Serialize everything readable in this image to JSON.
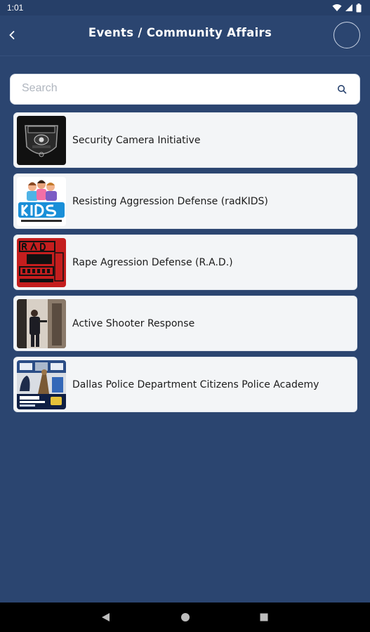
{
  "status_bar": {
    "time": "1:01"
  },
  "app_bar": {
    "title": "Events / Community Affairs"
  },
  "search": {
    "placeholder": "Search",
    "value": ""
  },
  "items": [
    {
      "label": "Security Camera Initiative",
      "thumb": "police-badge-image"
    },
    {
      "label": "Resisting Aggression Defense (radKIDS)",
      "thumb": "radkids-logo-image"
    },
    {
      "label": "Rape Agression Defense (R.A.D.)",
      "thumb": "rad-logo-image"
    },
    {
      "label": "Active Shooter Response",
      "thumb": "active-shooter-photo"
    },
    {
      "label": "Dallas Police Department Citizens Police Academy",
      "thumb": "police-academy-photo"
    }
  ],
  "colors": {
    "background": "#2b4570",
    "card": "#f3f5f7",
    "accent_red": "#c41e1e"
  }
}
